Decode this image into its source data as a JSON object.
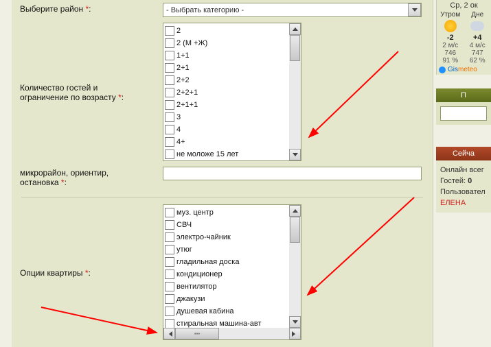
{
  "form": {
    "district": {
      "label": "Выберите район ",
      "selected": "- Выбрать категорию -"
    },
    "guests": {
      "label_l1": "Количество гостей и",
      "label_l2": "ограничение по возрасту ",
      "options": [
        "2",
        "2 (М +Ж)",
        "1+1",
        "2+1",
        "2+2",
        "2+2+1",
        "2+1+1",
        "3",
        "4",
        "4+",
        "не моложе 15 лет"
      ]
    },
    "micro": {
      "label_l1": "микрорайон, ориентир,",
      "label_l2": "остановка ",
      "value": ""
    },
    "options": {
      "label": "Опции квартиры ",
      "options": [
        "муз. центр",
        "СВЧ",
        "электро-чайник",
        "утюг",
        "гладильная доска",
        "кондиционер",
        "вентилятор",
        "джакузи",
        "душевая кабина",
        "стиральная машина-авт"
      ]
    }
  },
  "weather": {
    "date": "Ср, 2 ок",
    "col1_head": "Утром",
    "col2_head": "Дне",
    "col1_temp": "-2",
    "col2_temp": "+4",
    "col1_wind": "2 м/с",
    "col2_wind": "4 м/с",
    "col1_p": "746",
    "col2_p": "747",
    "col1_h": "91 %",
    "col2_h": "62 %",
    "brand1": "Gis",
    "brand2": "meteo"
  },
  "searchbar": {
    "title": "П"
  },
  "nowbar": {
    "title": "Сейча"
  },
  "users": {
    "online": "Онлайн всег",
    "guests_lbl": "Гостей: ",
    "guests_n": "0",
    "users_lbl": "Пользовател",
    "user_name": "ЕЛЕНА"
  }
}
